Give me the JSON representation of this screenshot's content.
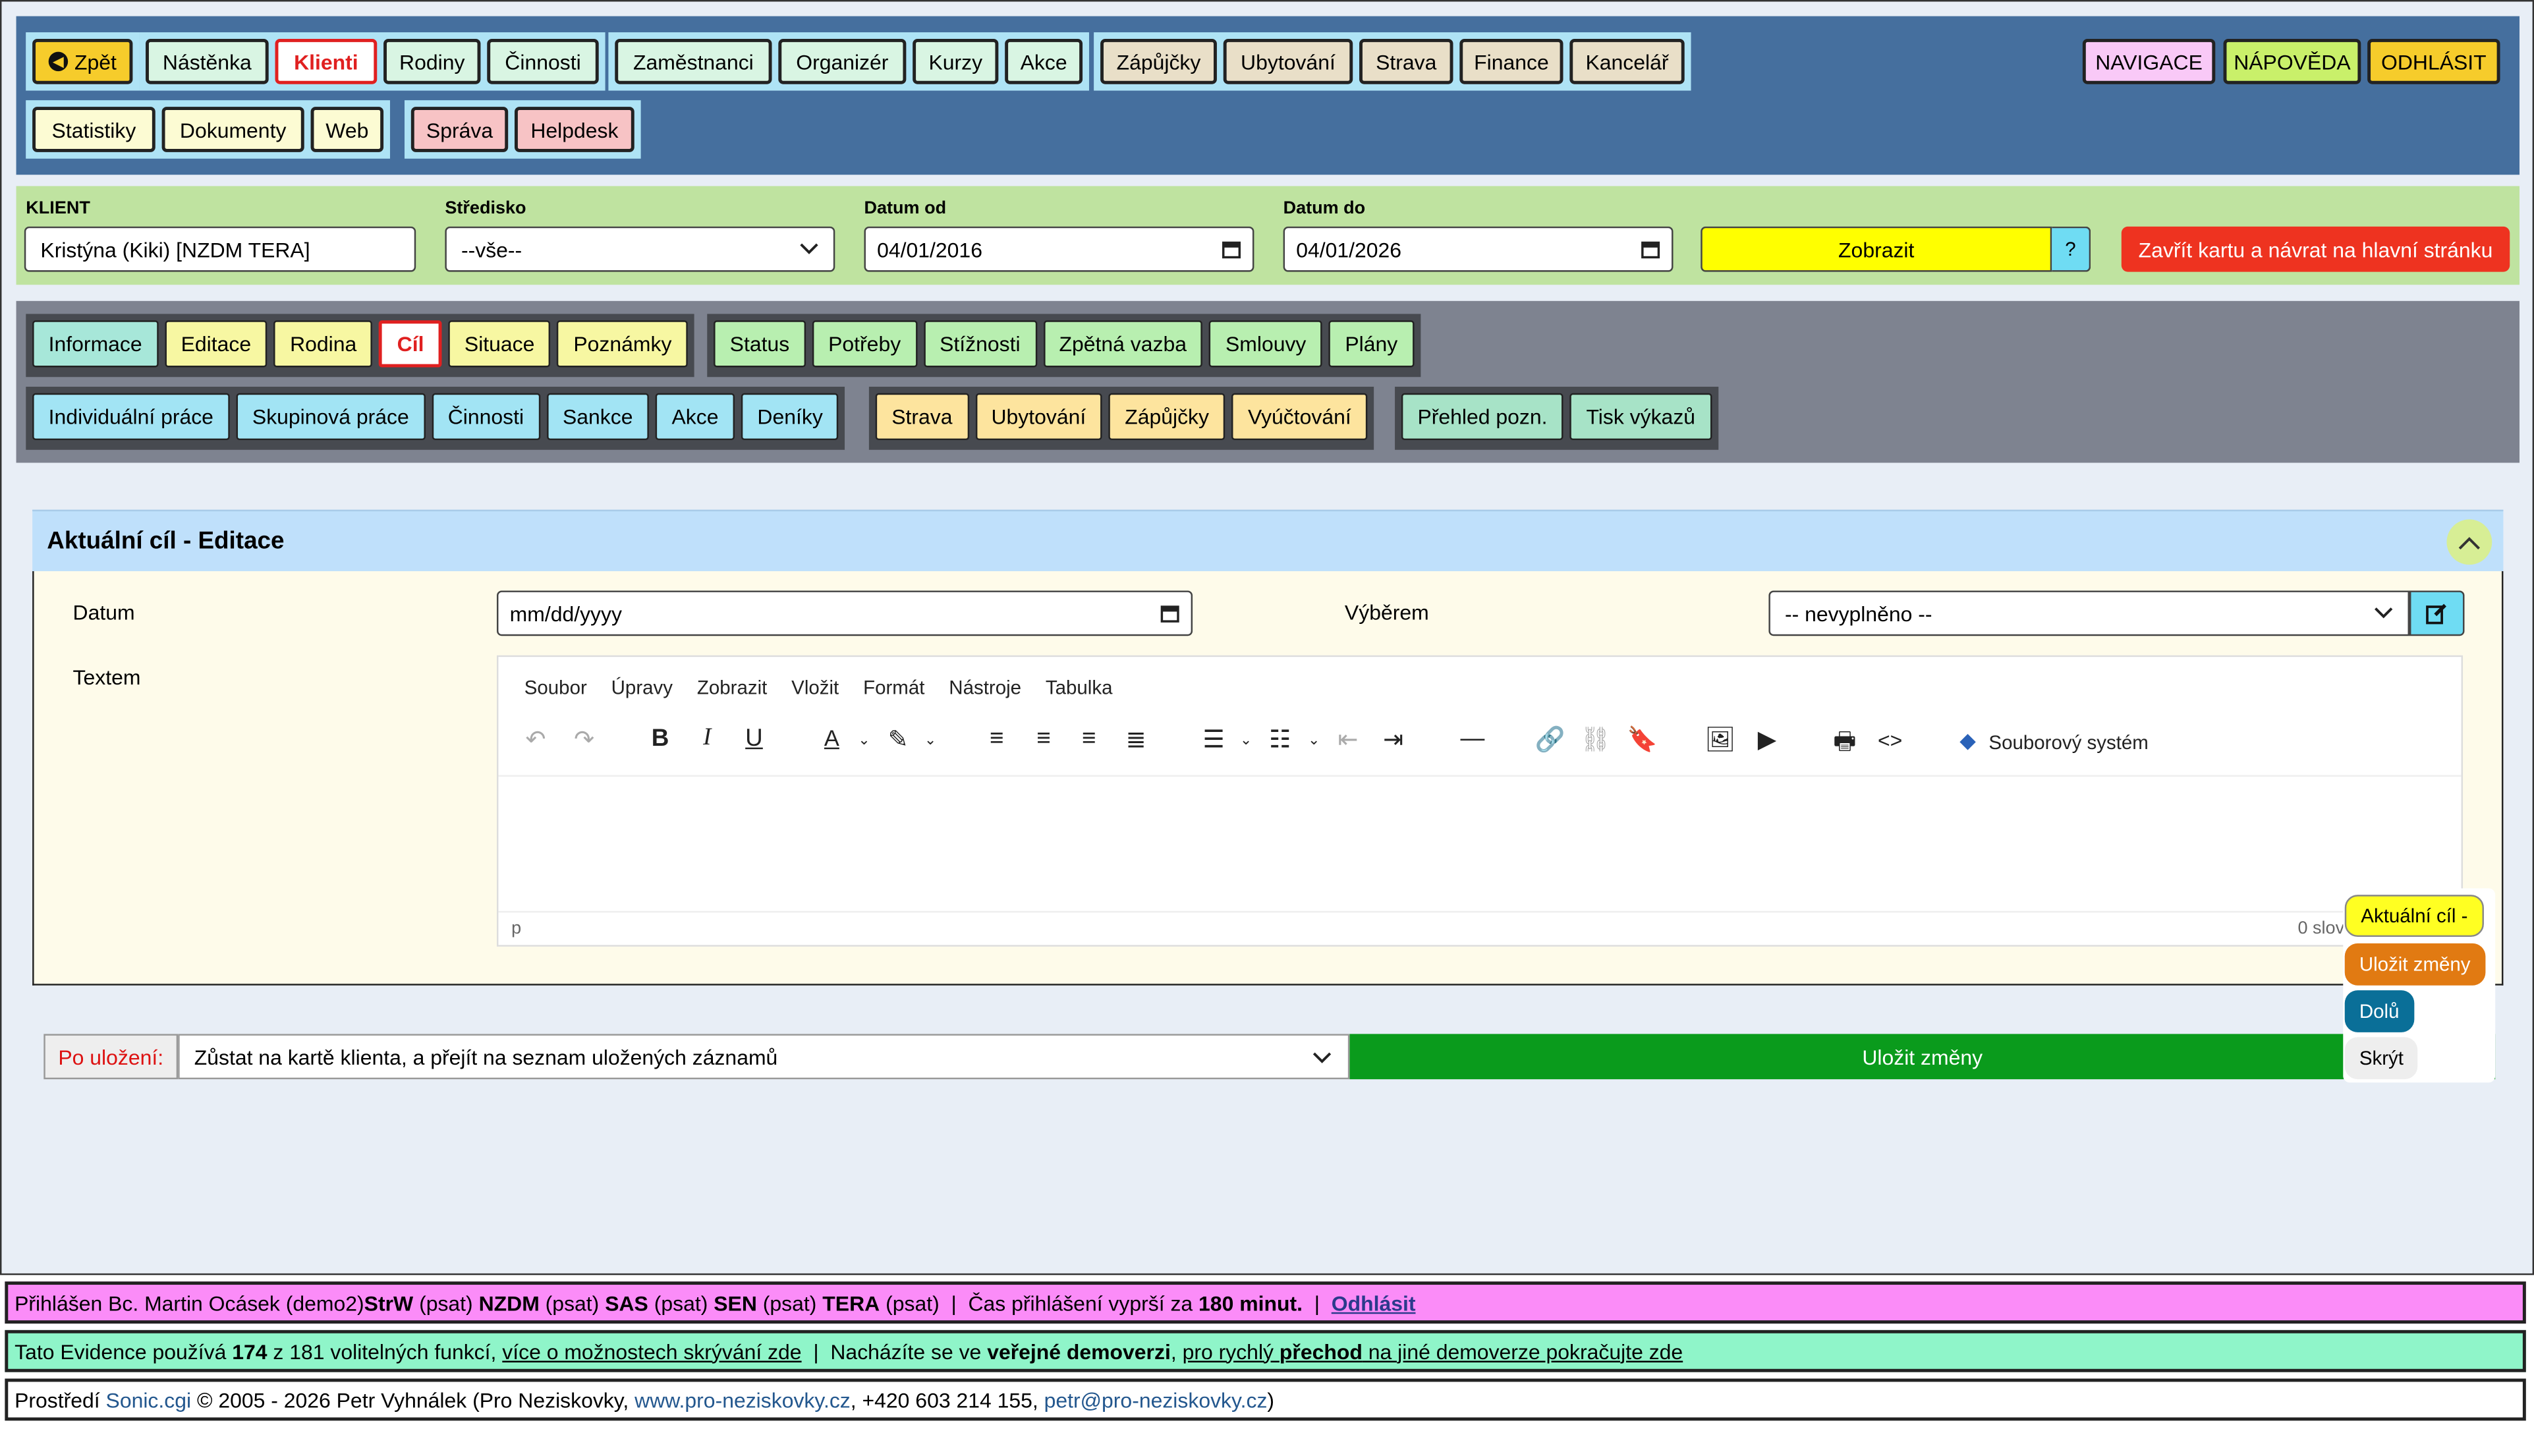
{
  "topnav": {
    "back": "Zpět",
    "group1": [
      "Nástěnka",
      "Klienti",
      "Rodiny",
      "Činnosti"
    ],
    "group2": [
      "Zaměstnanci",
      "Organizér",
      "Kurzy",
      "Akce"
    ],
    "group3": [
      "Zápůjčky",
      "Ubytování",
      "Strava",
      "Finance",
      "Kancelář"
    ],
    "row2_group1": [
      "Statistiky",
      "Dokumenty",
      "Web"
    ],
    "row2_group2": [
      "Správa",
      "Helpdesk"
    ],
    "navigace": "NAVIGACE",
    "napoveda": "NÁPOVĚDA",
    "odhlasit": "ODHLÁSIT"
  },
  "filter": {
    "client_label": "KLIENT",
    "client_value": "Kristýna (Kiki) [NZDM TERA]",
    "center_label": "Středisko",
    "center_value": "--vše--",
    "date_from_label": "Datum od",
    "date_from_value": "04/01/2016",
    "date_to_label": "Datum do",
    "date_to_value": "04/01/2026",
    "show": "Zobrazit",
    "help": "?",
    "close": "Zavřít kartu a návrat na hlavní stránku"
  },
  "tabs": {
    "row1a": [
      "Informace",
      "Editace",
      "Rodina",
      "Cíl",
      "Situace",
      "Poznámky"
    ],
    "row1b": [
      "Status",
      "Potřeby",
      "Stížnosti",
      "Zpětná vazba",
      "Smlouvy",
      "Plány"
    ],
    "row2a": [
      "Individuální práce",
      "Skupinová práce",
      "Činnosti",
      "Sankce",
      "Akce",
      "Deníky"
    ],
    "row2b": [
      "Strava",
      "Ubytování",
      "Zápůjčky",
      "Vyúčtování"
    ],
    "row2c": [
      "Přehled pozn.",
      "Tisk výkazů"
    ]
  },
  "panel": {
    "title": "Aktuální cíl - Editace",
    "date_label": "Datum",
    "date_placeholder": "mm/dd/yyyy",
    "select_label": "Výběrem",
    "select_value": "-- nevyplněno --",
    "text_label": "Textem",
    "editor_menu": [
      "Soubor",
      "Úpravy",
      "Zobrazit",
      "Vložit",
      "Formát",
      "Nástroje",
      "Tabulka"
    ],
    "file_system": "Souborový systém",
    "status_path": "p",
    "word_count": "0 slov"
  },
  "savebar": {
    "after_label": "Po uložení:",
    "after_value": "Zůstat na kartě klienta, a přejít na seznam uložených záznamů",
    "save": "Uložit změny"
  },
  "floating": {
    "current": "Aktuální cíl -",
    "save": "Uložit změny",
    "down": "Dolů",
    "hide": "Skrýt"
  },
  "footer": {
    "l1_a": "Přihlášen Bc. Martin Ocásek (demo2) ",
    "l1_b": "StrW",
    "l1_c": " (psat) ",
    "l1_d": "NZDM",
    "l1_e": " (psat) ",
    "l1_f": "SAS",
    "l1_g": " (psat) ",
    "l1_h": "SEN",
    "l1_i": " (psat) ",
    "l1_j": "TERA",
    "l1_k": " (psat)  |  Čas přihlášení vyprší za ",
    "l1_l": "180 minut.",
    "l1_m": "  |  ",
    "l1_n": "Odhlásit",
    "l2_a": "Tato Evidence používá ",
    "l2_b": "174",
    "l2_c": " z 181 volitelných funkcí, ",
    "l2_d": "více o možnostech skrývání zde",
    "l2_e": "  |  Nacházíte se ve ",
    "l2_f": "veřejné demoverzi",
    "l2_g": ", ",
    "l2_h": "pro rychlý ",
    "l2_i": "přechod",
    "l2_j": " na jiné demoverze pokračujte zde",
    "l3_a": "Prostředí ",
    "l3_b": "Sonic.cgi",
    "l3_c": " © 2005 - 2026 Petr Vyhnálek (Pro Neziskovky, ",
    "l3_d": "www.pro-neziskovky.cz",
    "l3_e": ", +420 603 214 155, ",
    "l3_f": "petr@pro-neziskovky.cz",
    "l3_g": ")"
  }
}
